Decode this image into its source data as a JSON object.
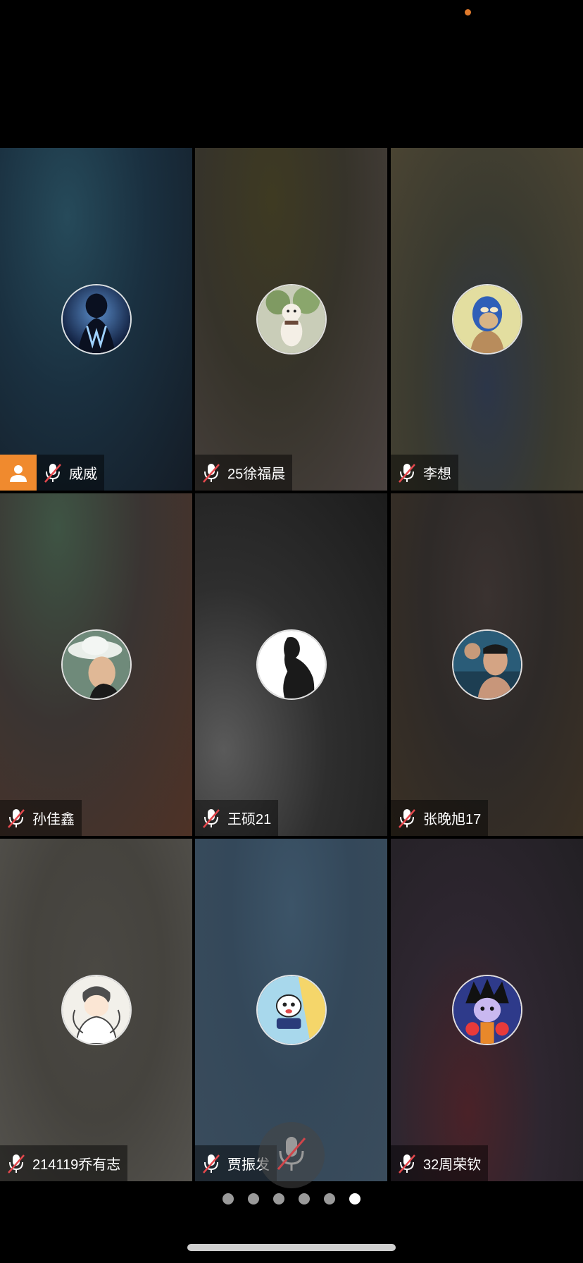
{
  "status": {
    "indicator_color": "#e07a2c"
  },
  "participants": [
    {
      "name": "威威",
      "mic": "muted",
      "is_host": true,
      "avatar_icon": "alan-walker-avatar"
    },
    {
      "name": "25徐福晨",
      "mic": "muted",
      "is_host": false,
      "avatar_icon": "dog-avatar"
    },
    {
      "name": "李想",
      "mic": "muted",
      "is_host": false,
      "avatar_icon": "ape-avatar"
    },
    {
      "name": "孙佳鑫",
      "mic": "muted",
      "is_host": false,
      "avatar_icon": "cowboy-hat-avatar"
    },
    {
      "name": "王硕21",
      "mic": "muted",
      "is_host": false,
      "avatar_icon": "silhouette-avatar"
    },
    {
      "name": "张晚旭17",
      "mic": "muted",
      "is_host": false,
      "avatar_icon": "pool-photo-avatar"
    },
    {
      "name": "214119乔有志",
      "mic": "muted",
      "is_host": false,
      "avatar_icon": "cartoon-hug-avatar"
    },
    {
      "name": "贾振发",
      "mic": "muted",
      "is_host": false,
      "avatar_icon": "cartoon-kid-avatar"
    },
    {
      "name": "32周荣钦",
      "mic": "muted",
      "is_host": false,
      "avatar_icon": "goku-avatar"
    }
  ],
  "controls": {
    "floating_mic": "mic-muted-icon"
  },
  "pagination": {
    "total": 6,
    "current": 6
  },
  "colors": {
    "host_badge": "#f08a2e",
    "mute_slash": "#e5484d"
  }
}
